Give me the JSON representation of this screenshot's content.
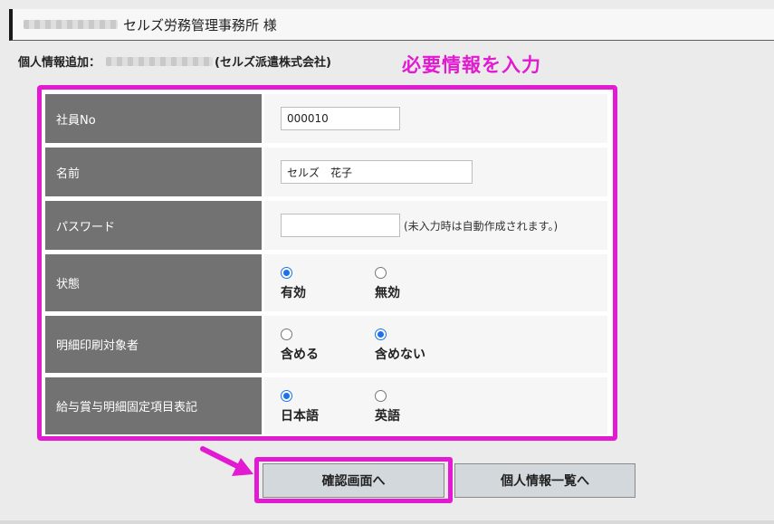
{
  "header": {
    "title": "セルズ労務管理事務所 様"
  },
  "subheader": {
    "prefix": "個人情報追加：",
    "company": "(セルズ派遣株式会社)"
  },
  "annotation": {
    "text": "必要情報を入力",
    "color": "#e21ad1"
  },
  "form": {
    "employee_no": {
      "label": "社員No",
      "value": "000010"
    },
    "name": {
      "label": "名前",
      "value": "セルズ　花子"
    },
    "password": {
      "label": "パスワード",
      "value": "",
      "hint": "(未入力時は自動作成されます。)"
    },
    "status": {
      "label": "状態",
      "options": [
        "有効",
        "無効"
      ],
      "selected": "有効"
    },
    "statement_print": {
      "label": "明細印刷対象者",
      "options": [
        "含める",
        "含めない"
      ],
      "selected": "含めない"
    },
    "item_language": {
      "label": "給与賞与明細固定項目表記",
      "options": [
        "日本語",
        "英語"
      ],
      "selected": "日本語"
    }
  },
  "buttons": {
    "confirm": "確認画面へ",
    "list": "個人情報一覧へ"
  },
  "colors": {
    "label_bg": "#727272",
    "accent": "#e21ad1",
    "radio": "#1a73e8",
    "button_bg": "#d3d8dc"
  }
}
